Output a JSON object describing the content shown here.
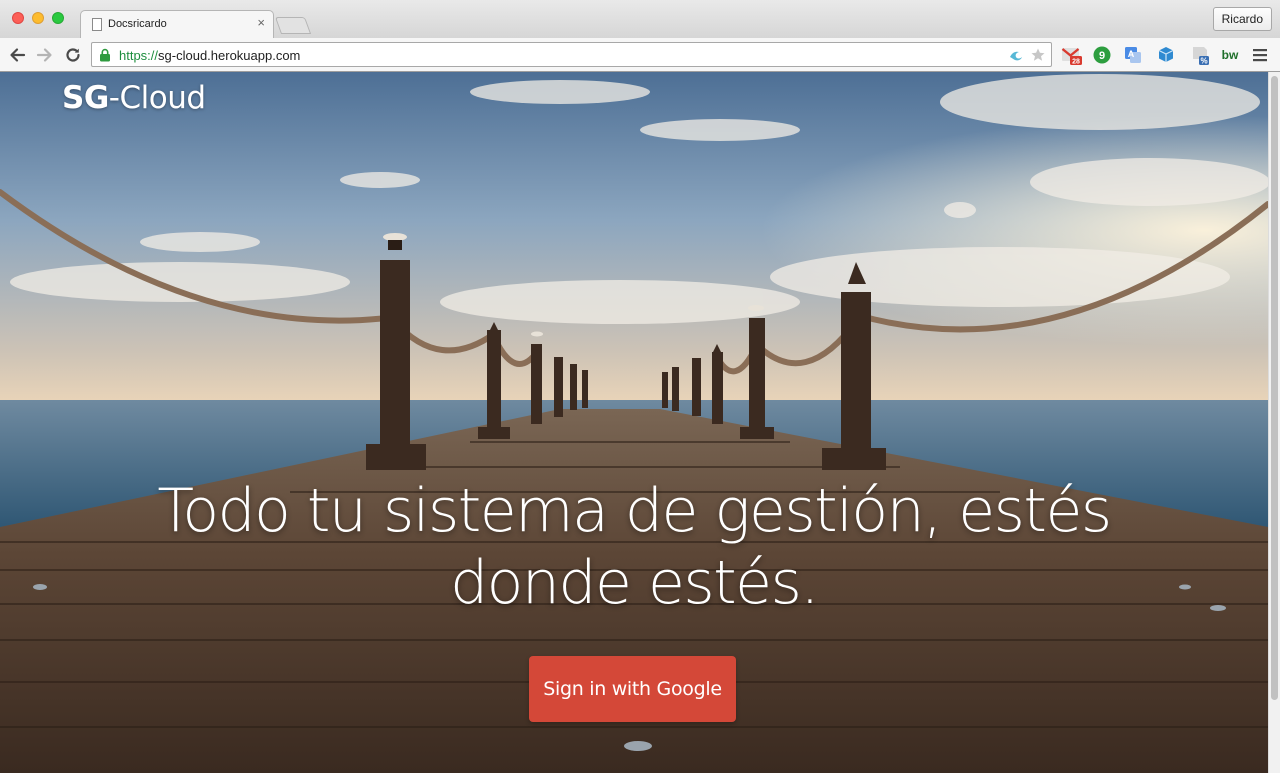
{
  "browser": {
    "tab_title": "Docsricardo",
    "tab_close": "×",
    "profile_name": "Ricardo",
    "url_scheme": "https://",
    "url_host": "sg-cloud.herokuapp.com",
    "gmail_badge": "28",
    "extensions": [
      "gmail-icon",
      "evernote-icon",
      "translate-icon",
      "cube-icon",
      "discount-icon",
      "bw-icon"
    ],
    "ext_bw_label": "bw"
  },
  "page": {
    "logo_bold": "SG",
    "logo_rest": "-Cloud",
    "headline_line1": "Todo tu sistema de gestión, estés",
    "headline_line2": "donde estés.",
    "cta_label": "Sign in with Google",
    "colors": {
      "cta": "#d44838",
      "sky": "#6f8fb0",
      "sea": "#3f6d8e",
      "dock": "#5a4538"
    }
  }
}
